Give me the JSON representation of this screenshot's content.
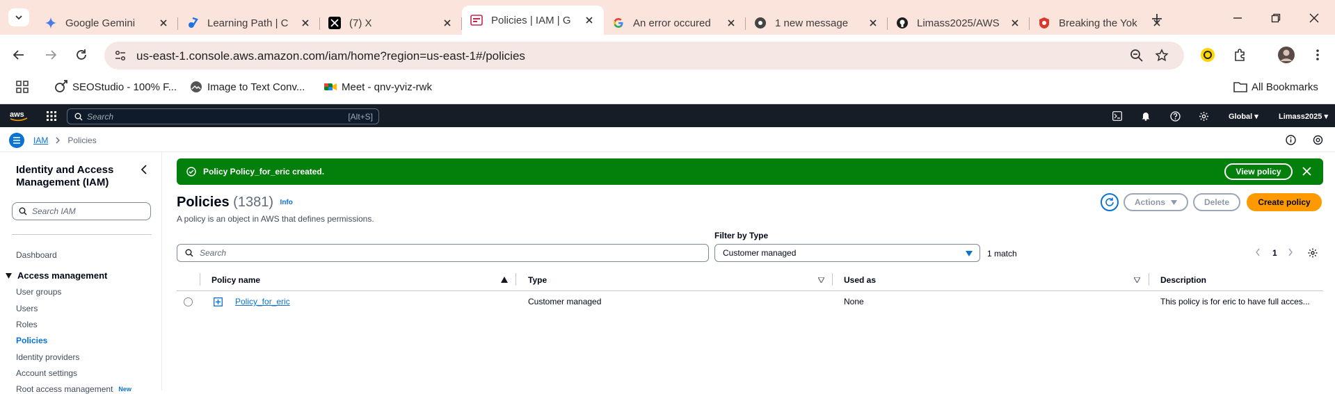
{
  "browser": {
    "tabs": [
      {
        "title": "Google Gemini",
        "icon": "gemini-icon"
      },
      {
        "title": "Learning Path | C",
        "icon": "learning-icon"
      },
      {
        "title": "(7) X",
        "icon": "x-logo-icon"
      },
      {
        "title": "Policies | IAM | G",
        "icon": "aws-console-icon",
        "active": true
      },
      {
        "title": "An error occured",
        "icon": "google-icon"
      },
      {
        "title": "1 new message",
        "icon": "message-icon"
      },
      {
        "title": "Limass2025/AWS",
        "icon": "github-icon"
      },
      {
        "title": "Breaking the Yok",
        "icon": "article-icon"
      }
    ],
    "url": "us-east-1.console.aws.amazon.com/iam/home?region=us-east-1#/policies",
    "bookmarks": [
      {
        "label": "SEOStudio - 100% F...",
        "icon": "seo-icon"
      },
      {
        "label": "Image to Text Conv...",
        "icon": "image-icon"
      },
      {
        "label": "Meet - qnv-yviz-rwk",
        "icon": "meet-icon"
      }
    ],
    "all_bookmarks": "All Bookmarks"
  },
  "aws": {
    "search_placeholder": "Search",
    "search_shortcut": "[Alt+S]",
    "region": "Global",
    "account": "Limass2025"
  },
  "breadcrumb": {
    "root": "IAM",
    "current": "Policies"
  },
  "sidebar": {
    "title": "Identity and Access Management (IAM)",
    "search_placeholder": "Search IAM",
    "dashboard": "Dashboard",
    "section": "Access management",
    "items": [
      "User groups",
      "Users",
      "Roles",
      "Policies",
      "Identity providers",
      "Account settings",
      "Root access management"
    ],
    "new_badge": "New"
  },
  "flash": {
    "message": "Policy Policy_for_eric created.",
    "button": "View policy"
  },
  "header": {
    "title": "Policies",
    "count": "(1381)",
    "info": "Info",
    "description": "A policy is an object in AWS that defines permissions.",
    "actions": "Actions",
    "delete": "Delete",
    "create": "Create policy"
  },
  "filters": {
    "search_placeholder": "Search",
    "filter_label": "Filter by Type",
    "filter_value": "Customer managed",
    "matches": "1 match",
    "page": "1"
  },
  "table": {
    "columns": [
      "Policy name",
      "Type",
      "Used as",
      "Description"
    ],
    "rows": [
      {
        "name": "Policy_for_eric",
        "type": "Customer managed",
        "used_as": "None",
        "description": "This policy is for eric to have full acces..."
      }
    ]
  },
  "colors": {
    "aws_nav": "#161d26",
    "success": "#037f0c",
    "primary": "#ff9900",
    "link": "#0972d3",
    "tab_strip": "#fbe4dc"
  }
}
